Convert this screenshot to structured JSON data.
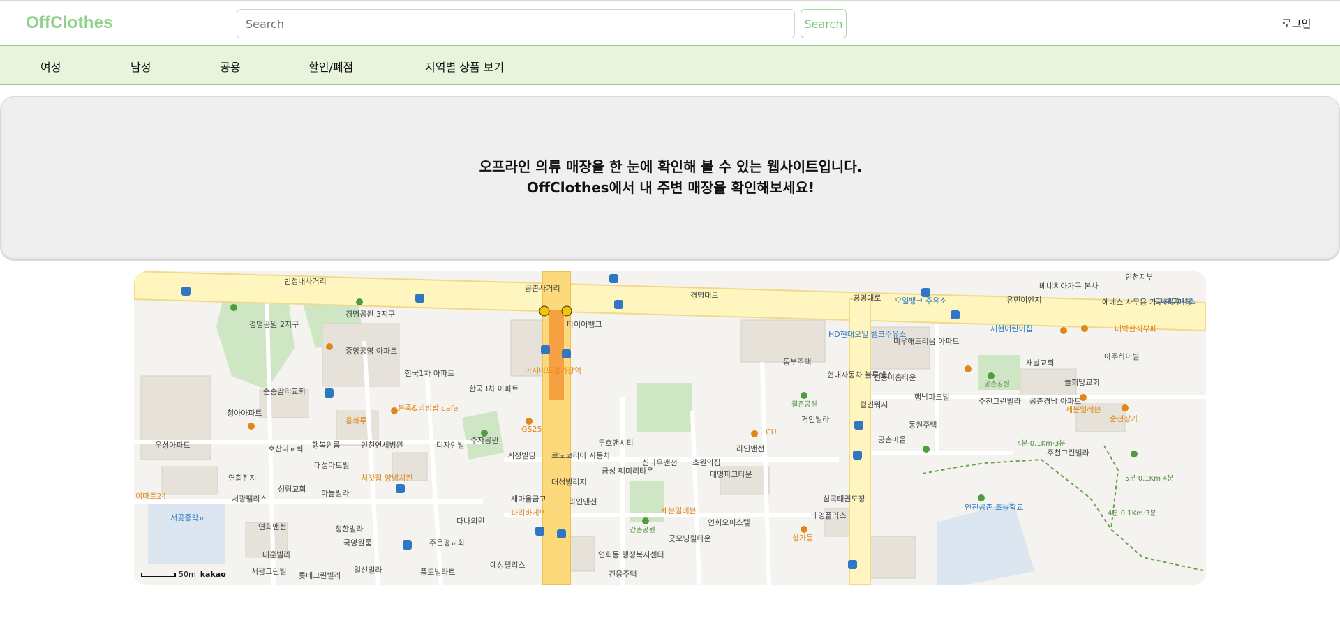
{
  "header": {
    "logo": "OffClothes",
    "search_placeholder": "Search",
    "search_button": "Search",
    "login": "로그인"
  },
  "nav": {
    "items": [
      "여성",
      "남성",
      "공용",
      "할인/폐점",
      "지역별 상품 보기"
    ]
  },
  "hero": {
    "line1": "오프라인 의류 매장을 한 눈에 확인해 볼 수 있는 웹사이트입니다.",
    "line2": "OffClothes에서 내 주변 매장을 확인해보세요!"
  },
  "map": {
    "scale_label": "50m",
    "provider": "kakao",
    "labels": {
      "l01": "빈정내사거리",
      "l02": "공촌사거리",
      "l03": "경명대로",
      "l04": "경명공원 2지구",
      "l05": "경명공원 3지구",
      "l06": "중앙공영 아파트",
      "l07": "타이어뱅크",
      "l08": "아시아드경기장역",
      "l09": "한국1차 아파트",
      "l10": "한국3차 아파트",
      "l11": "순종감리교회",
      "l12": "청아아파트",
      "l13": "홍화루",
      "l14": "본죽&비빔밥 cafe",
      "l15": "우성아파트",
      "l16": "호산나교회",
      "l17": "행복원룸",
      "l18": "인천연세병원",
      "l19": "디자인빌",
      "l20": "대성아트빌",
      "l21": "주자공원",
      "l22": "계정빌딩",
      "l23": "르노코리아 자동차",
      "l24": "두호앤시티",
      "l25": "연희진지",
      "l26": "성림교회",
      "l27": "하늘빌라",
      "l28": "처갓집 양념치킨",
      "l29": "대성빌리지",
      "l30": "금성 훼미리타운",
      "l31": "신다우맨션",
      "l32": "초원의집",
      "l33": "라인맨션",
      "l34": "대명파크타운",
      "l35": "이마트24",
      "l36": "서광펠리스",
      "l37": "서곶중학교",
      "l38": "새마을금고",
      "l39": "라인맨션",
      "l40": "파리바게뜨",
      "l41": "연희맨션",
      "l42": "정한빌라",
      "l43": "다나의원",
      "l44": "국영원룸",
      "l45": "주은평교회",
      "l46": "세븐일레븐",
      "l47": "연희오피스텔",
      "l48": "간촌공원",
      "l49": "굿모닝힐타운",
      "l50": "연희동 행정복지센터",
      "l51": "대훈빌라",
      "l52": "일신빌라",
      "l53": "풍도빌라트",
      "l54": "예성펠리스",
      "l55": "건웅주택",
      "l56": "서광그린빌",
      "l57": "롯데그린빌라",
      "l58": "HD현대오일 뱅크주유소",
      "l59": "미우해드리움 아파트",
      "l60": "동부주택",
      "l61": "현대자동차 블루핸즈",
      "l62": "신동아홈타운",
      "l63": "행남파크빌",
      "l64": "월촌공원",
      "l65": "컴인워시",
      "l66": "동원주택",
      "l67": "거인빌라",
      "l68": "공촌마을",
      "l69": "심곡태권도장",
      "l70": "태영플러스",
      "l71": "오일뱅크 주유소",
      "l72": "유민이엔지",
      "l73": "베네치아가구 본사",
      "l74": "에베스 사무용 가구전문매장",
      "l75": "S-oil 주유소",
      "l76": "인천지부",
      "l77": "재현어린이집",
      "l78": "대박한식부페",
      "l79": "아주하이빌",
      "l80": "새날교회",
      "l81": "늘희망교회",
      "l82": "공촌공원",
      "l83": "주천그린빌라",
      "l84": "공촌경남 아파트",
      "l85": "세분일레븐",
      "l86": "순천상가",
      "l87": "주천그린빌라",
      "l88": "인천공촌 초등학교",
      "l89": "상가동",
      "l90": "CU",
      "l91": "GS25",
      "l92": "4분·0.1Km·3분",
      "l93": "5분·0.1Km·4분",
      "l94": "4분·0.1Km·3분",
      "l95": "경명대로"
    }
  }
}
